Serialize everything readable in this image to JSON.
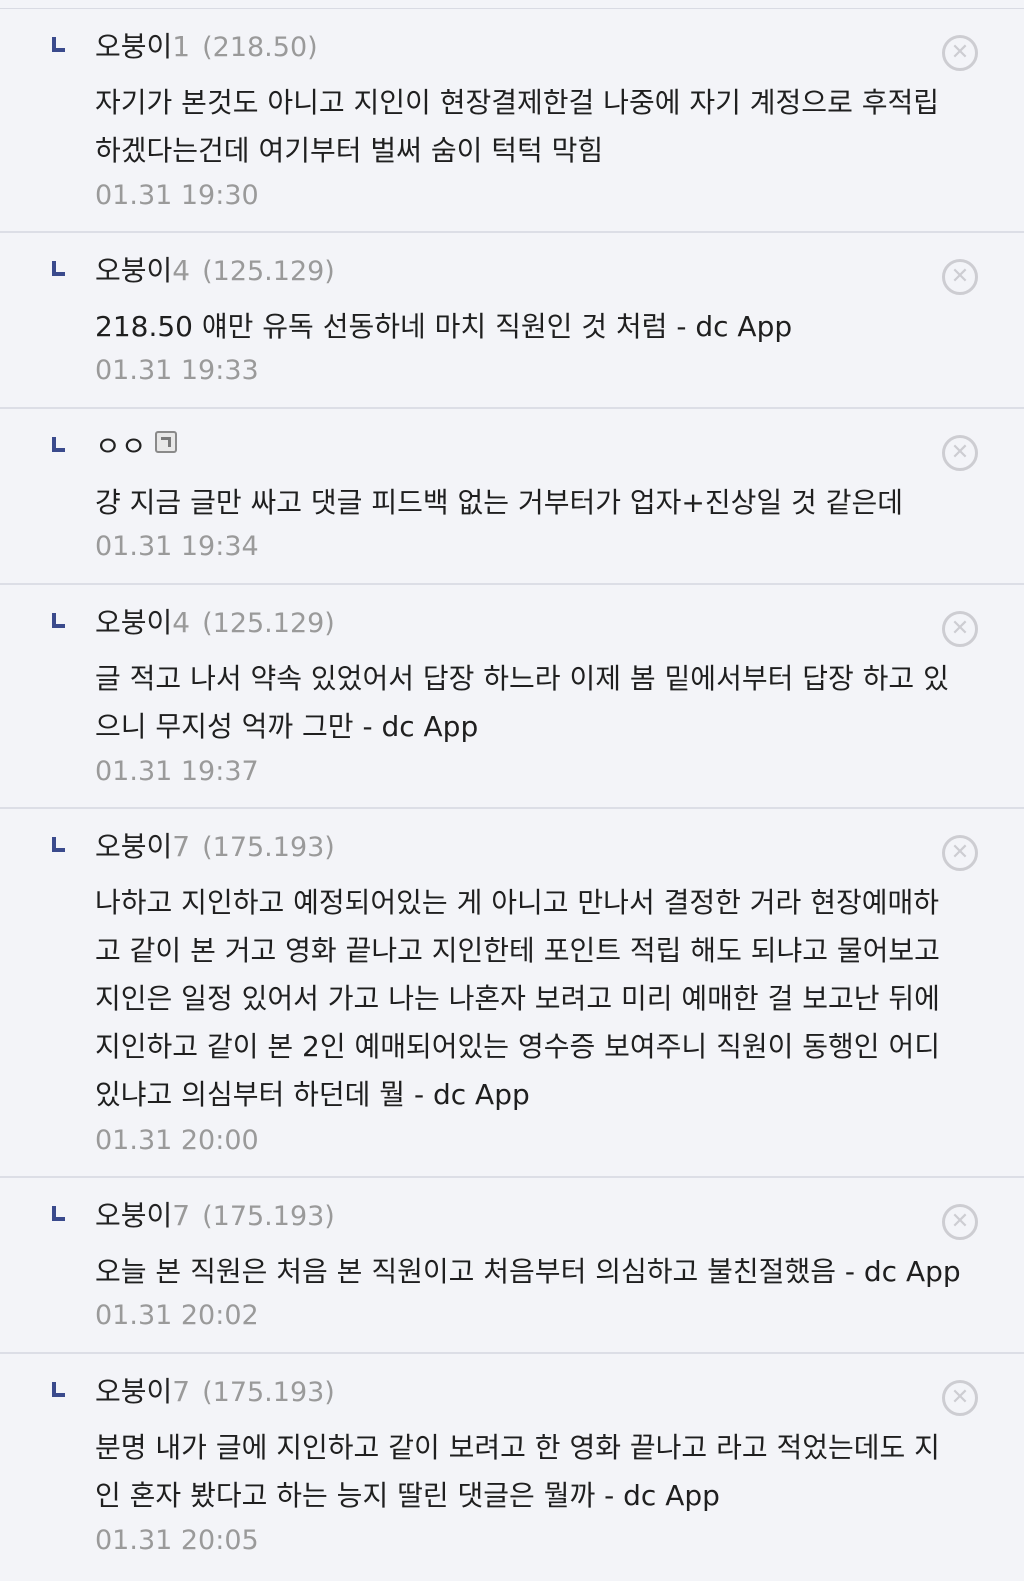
{
  "replies": [
    {
      "nick": "오붕이",
      "nick_num": "1",
      "ip": "(218.50)",
      "text": "자기가 본것도 아니고 지인이 현장결제한걸 나중에 자기 계정으로 후적립\n하겠다는건데 여기부터 벌써 숨이 턱턱 막힘",
      "date": "01.31 19:30",
      "delete_icon": "x-circle-icon"
    },
    {
      "nick": "오붕이",
      "nick_num": "4",
      "ip": "(125.129)",
      "text": "218.50 얘만 유독 선동하네 마치 직원인 것 처럼 - dc App",
      "date": "01.31 19:33",
      "delete_icon": "x-circle-icon"
    },
    {
      "nick": "ㅇㅇ",
      "nick_num": "",
      "ip": "",
      "text": "걍 지금 글만 싸고 댓글 피드백 없는 거부터가 업자+진상일 것 같은데",
      "date": "01.31 19:34",
      "delete_icon": "x-circle-icon",
      "gallery_icon": "fixed-nick-icon"
    },
    {
      "nick": "오붕이",
      "nick_num": "4",
      "ip": "(125.129)",
      "text": "글 적고 나서 약속 있었어서 답장 하느라 이제 봄 밑에서부터 답장 하고 있\n으니 무지성 억까 그만 - dc App",
      "date": "01.31 19:37",
      "delete_icon": "x-circle-icon"
    },
    {
      "nick": "오붕이",
      "nick_num": "7",
      "ip": "(175.193)",
      "text": "나하고 지인하고 예정되어있는 게 아니고 만나서 결정한 거라 현장예매하\n고 같이 본 거고 영화 끝나고 지인한테 포인트 적립 해도 되냐고 물어보고\n지인은 일정 있어서 가고 나는 나혼자 보려고 미리 예매한 걸 보고난 뒤에\n지인하고 같이 본 2인 예매되어있는 영수증 보여주니 직원이 동행인 어디\n있냐고 의심부터 하던데 뭘 - dc App",
      "date": "01.31 20:00",
      "delete_icon": "x-circle-icon"
    },
    {
      "nick": "오붕이",
      "nick_num": "7",
      "ip": "(175.193)",
      "text": "오늘 본 직원은 처음 본 직원이고 처음부터 의심하고 불친절했음 - dc App",
      "date": "01.31 20:02",
      "delete_icon": "x-circle-icon"
    },
    {
      "nick": "오붕이",
      "nick_num": "7",
      "ip": "(175.193)",
      "text": "분명 내가 글에 지인하고 같이 보려고 한 영화 끝나고 라고 적었는데도 지\n인 혼자 봤다고 하는 능지 딸린 댓글은 뭘까 - dc App",
      "date": "01.31 20:05",
      "delete_icon": "x-circle-icon"
    }
  ],
  "reply_arrow_icon": "reply-arrow-icon",
  "delete_glyph": "✕",
  "colors": {
    "background": "#f3f4f8",
    "reply_arrow": "#3a4a8c",
    "meta_gray": "#9a9a9a",
    "text": "#1f1f1f"
  }
}
